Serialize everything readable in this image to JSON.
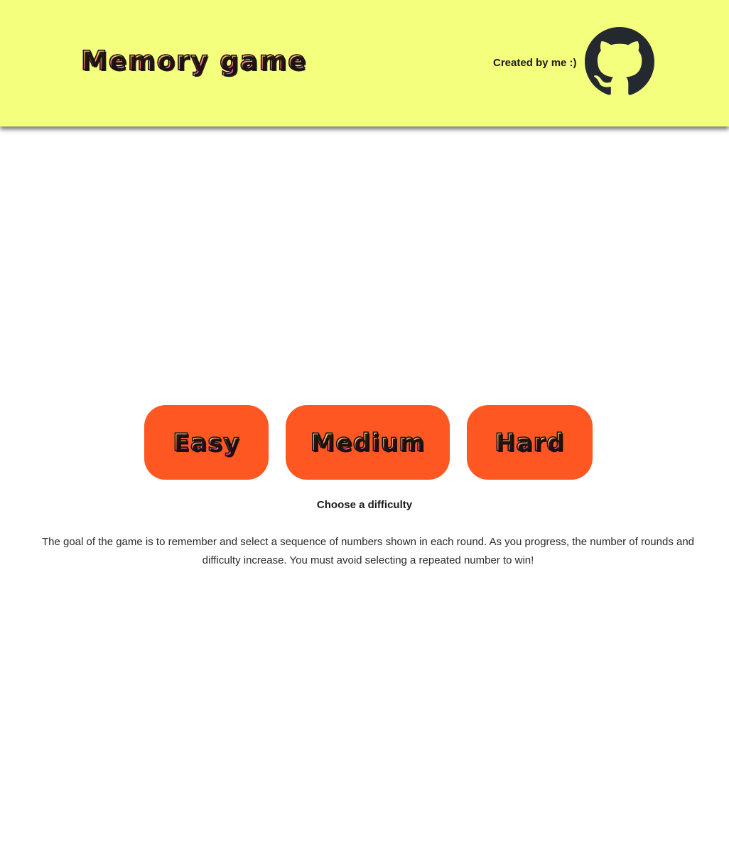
{
  "header": {
    "title": "Memory game",
    "credit": "Created by me :)",
    "github_icon": "github-icon",
    "background_color": "#f4ff7e"
  },
  "difficulty": {
    "buttons": [
      {
        "label": "Easy"
      },
      {
        "label": "Medium"
      },
      {
        "label": "Hard"
      }
    ],
    "button_color": "#ff5722",
    "prompt": "Choose a difficulty"
  },
  "description": "The goal of the game is to remember and select a sequence of numbers shown in each round. As you progress, the number of rounds and difficulty increase. You must avoid selecting a repeated number to win!"
}
